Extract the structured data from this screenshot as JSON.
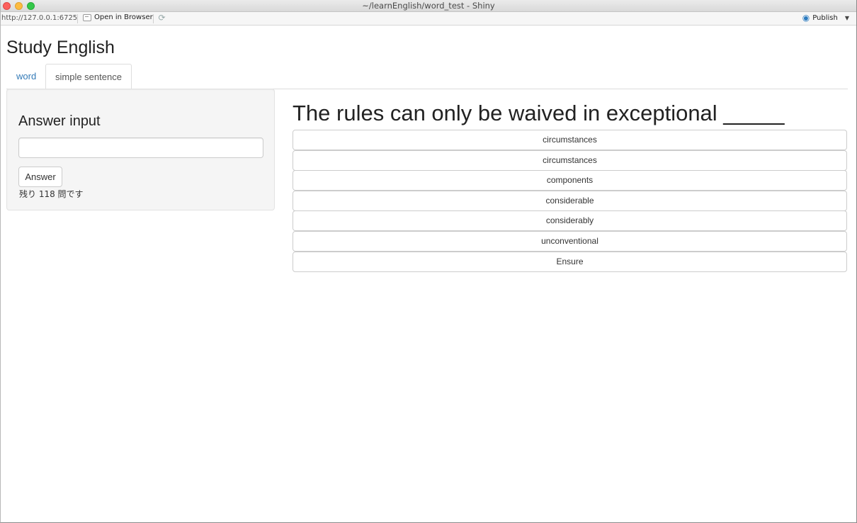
{
  "window": {
    "title": "~/learnEnglish/word_test - Shiny"
  },
  "toolbar": {
    "url": "http://127.0.0.1:6725",
    "open_in_browser": "Open in Browser",
    "publish": "Publish"
  },
  "app": {
    "title": "Study English",
    "tabs": [
      {
        "label": "word",
        "active": false
      },
      {
        "label": "simple sentence",
        "active": true
      }
    ],
    "sidebar": {
      "heading": "Answer input",
      "input_value": "",
      "input_placeholder": "",
      "button_label": "Answer",
      "remaining_text": "残り 118 問です"
    },
    "main": {
      "question": "The rules can only be waived in exceptional _____",
      "choices": [
        "circumstances",
        "circumstances",
        "components",
        "considerable",
        "considerably",
        "unconventional",
        "Ensure"
      ]
    }
  },
  "colors": {
    "link": "#337ab7",
    "panel_bg": "#f5f5f5",
    "border": "#cccccc"
  }
}
